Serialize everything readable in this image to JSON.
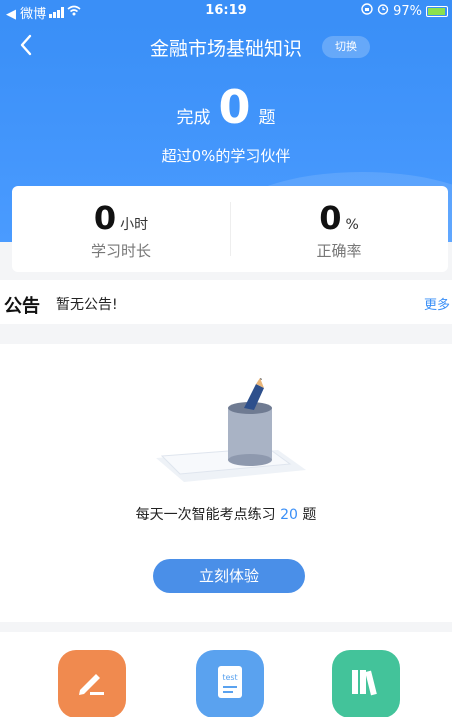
{
  "status_bar": {
    "carrier": "◀ 微博",
    "time": "16:19",
    "battery": "97%"
  },
  "header": {
    "title": "金融市场基础知识",
    "switch_label": "切换",
    "done_prefix": "完成",
    "done_count": "0",
    "done_suffix": "题",
    "beat_text": "超过0%的学习伙伴"
  },
  "stats": {
    "study_time_value": "0",
    "study_time_unit": "小时",
    "study_time_label": "学习时长",
    "accuracy_value": "0",
    "accuracy_unit": "%",
    "accuracy_label": "正确率"
  },
  "notice": {
    "tag": "公告",
    "text": "暂无公告!",
    "more": "更多"
  },
  "practice": {
    "desc_prefix": "每天一次智能考点练习 ",
    "desc_count": "20",
    "desc_suffix": " 题",
    "button_label": "立刻体验"
  },
  "bottom_icons": {
    "b1": "edit-note-icon",
    "b2": "test-paper-icon",
    "b3": "books-icon",
    "test_text": "test"
  },
  "colors": {
    "primary": "#3a8ff7",
    "orange": "#f08a4f",
    "blue": "#5aa2ef",
    "green": "#43c39a"
  }
}
